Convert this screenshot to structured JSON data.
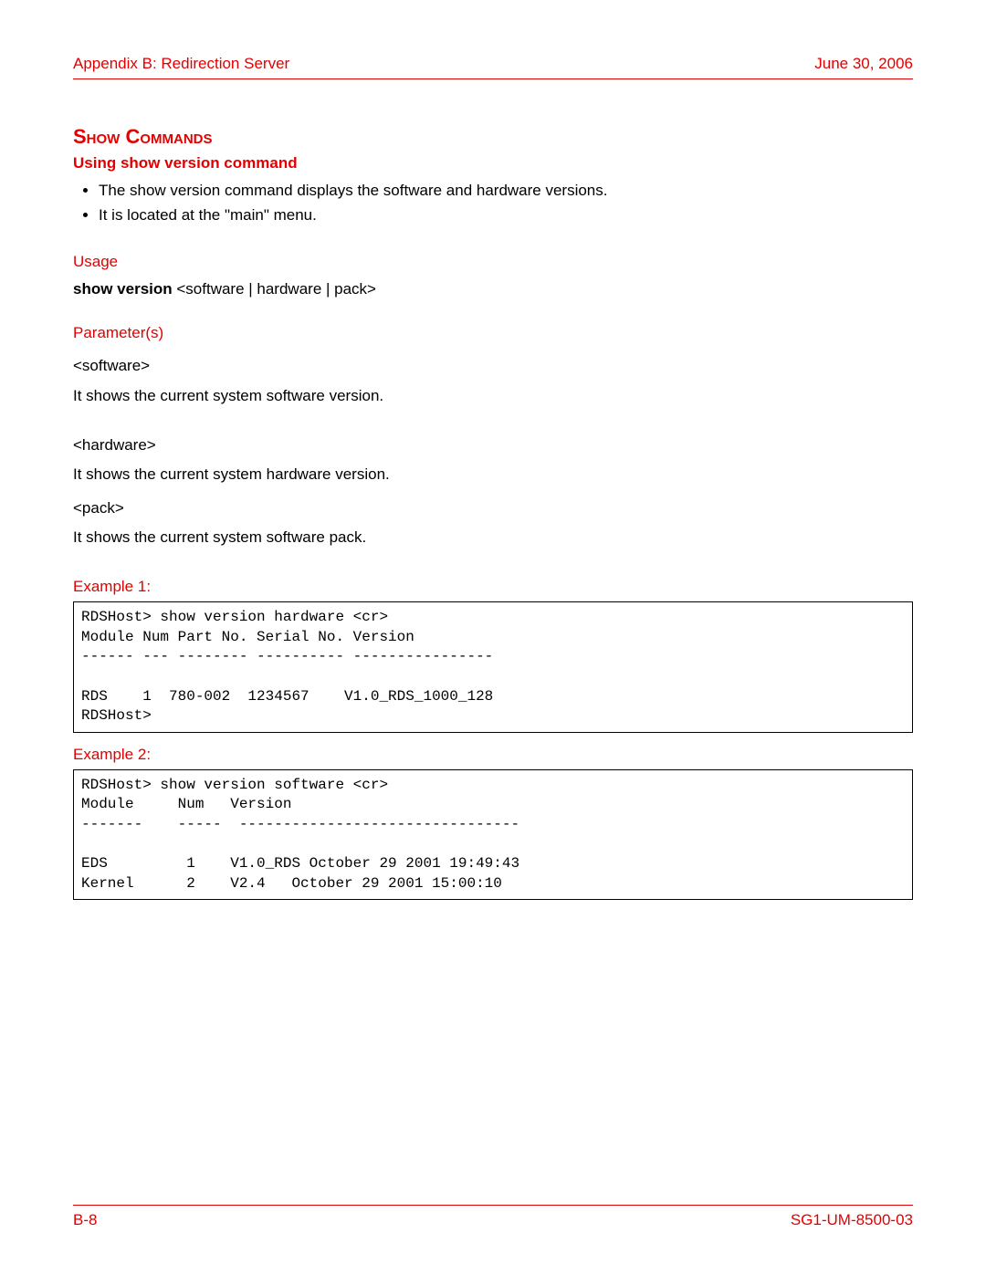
{
  "header": {
    "left": "Appendix B: Redirection Server",
    "right": "June 30, 2006"
  },
  "section_heading": "Show Commands",
  "subheading": "Using show version command",
  "bullets": [
    "The show version command displays the software and hardware versions.",
    "It is located at the \"main\" menu."
  ],
  "usage": {
    "label": "Usage",
    "command_bold": "show version",
    "command_rest": " <software | hardware | pack>"
  },
  "parameters": {
    "label": "Parameter(s)",
    "items": [
      {
        "name": "<software>",
        "desc": "It shows the current system software version."
      },
      {
        "name": "<hardware>",
        "desc": "It shows the current system hardware version."
      },
      {
        "name": "<pack>",
        "desc": "It shows the current system software pack."
      }
    ]
  },
  "example1": {
    "label": "Example 1:",
    "code": "RDSHost> show version hardware <cr>\nModule Num Part No. Serial No. Version\n------ --- -------- ---------- ----------------\n\nRDS    1  780-002  1234567    V1.0_RDS_1000_128\nRDSHost>"
  },
  "example2": {
    "label": "Example 2:",
    "code": "RDSHost> show version software <cr>\nModule     Num   Version\n-------    -----  --------------------------------\n\nEDS         1    V1.0_RDS October 29 2001 19:49:43\nKernel      2    V2.4   October 29 2001 15:00:10"
  },
  "footer": {
    "left": "B-8",
    "right": "SG1-UM-8500-03"
  }
}
